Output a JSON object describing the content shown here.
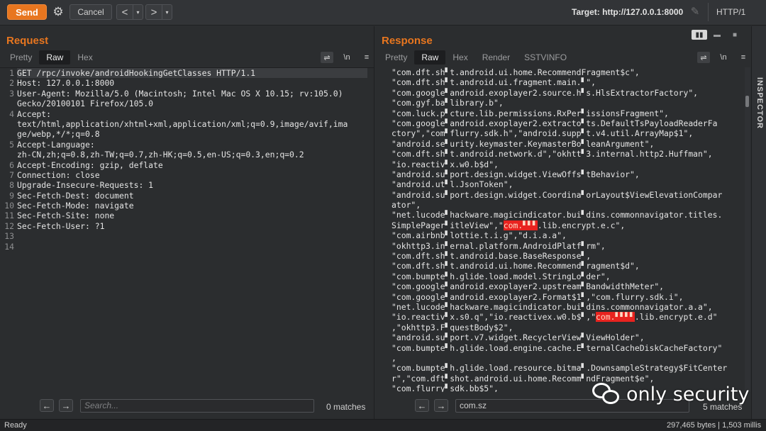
{
  "toolbar": {
    "send_label": "Send",
    "cancel_label": "Cancel",
    "back_arrow": "<",
    "forward_arrow": ">",
    "dropdown": "▾",
    "target": "Target: http://127.0.0.1:8000",
    "http_version": "HTTP/1"
  },
  "request": {
    "title": "Request",
    "tabs": [
      "Pretty",
      "Raw",
      "Hex"
    ],
    "active_tab": "Raw",
    "newline_label": "\\n",
    "line_numbers": [
      "1",
      "2",
      "3",
      "",
      "4",
      "",
      "",
      "5",
      "",
      "6",
      "7",
      "8",
      "9",
      "10",
      "11",
      "12",
      "13",
      "14"
    ],
    "lines": [
      "GET /rpc/invoke/androidHookingGetClasses HTTP/1.1",
      "Host: 127.0.0.1:8000",
      "User-Agent: Mozilla/5.0 (Macintosh; Intel Mac OS X 10.15; rv:105.0)",
      "Gecko/20100101 Firefox/105.0",
      "Accept:",
      "text/html,application/xhtml+xml,application/xml;q=0.9,image/avif,ima",
      "ge/webp,*/*;q=0.8",
      "Accept-Language:",
      "zh-CN,zh;q=0.8,zh-TW;q=0.7,zh-HK;q=0.5,en-US;q=0.3,en;q=0.2",
      "Accept-Encoding: gzip, deflate",
      "Connection: close",
      "Upgrade-Insecure-Requests: 1",
      "Sec-Fetch-Dest: document",
      "Sec-Fetch-Mode: navigate",
      "Sec-Fetch-Site: none",
      "Sec-Fetch-User: ?1",
      "",
      ""
    ],
    "search_placeholder": "Search...",
    "matches": "0 matches"
  },
  "response": {
    "title": "Response",
    "tabs": [
      "Pretty",
      "Raw",
      "Hex",
      "Render",
      "SSTVINFO"
    ],
    "active_tab": "Raw",
    "newline_label": "\\n",
    "lines": [
      "\"com.dft.sh▘t.android.ui.home.RecommendFragment$c\",",
      "\"com.dft.sh▘t.android.ui.fragment.main.▘\",",
      "\"com.google▘android.exoplayer2.source.h▘s.HlsExtractorFactory\",",
      "\"com.gyf.ba▘library.b\",",
      "\"com.luck.p▘cture.lib.permissions.RxPer▘issionsFragment\",",
      "\"com.google▘android.exoplayer2.extracto▘ts.DefaultTsPayloadReaderFa",
      "ctory\",\"com▘flurry.sdk.h\",\"android.supp▘t.v4.util.ArrayMap$1\",",
      "\"android.se▘urity.keymaster.KeymasterBo▘leanArgument\",",
      "\"com.dft.sh▘t.android.network.d\",\"okhtt▘3.internal.http2.Huffman\",",
      "\"io.reactiv▘x.w0.b$d\",",
      "\"android.su▘port.design.widget.ViewOffs▘tBehavior\",",
      "\"android.ut▘l.JsonToken\",",
      "\"android.su▘port.design.widget.Coordina▘orLayout$ViewElevationCompar",
      "ator\",",
      "\"net.lucode▘hackware.magicindicator.bui▘dins.commonnavigator.titles.",
      "SimplePager▘itleView\",\"",
      "\"com.airbnb▘lottie.t.i.g\",\"d.i.a.a\",",
      "\"okhttp3.in▘ernal.platform.AndroidPlatf▘rm\",",
      "\"com.dft.sh▘t.android.base.BaseResponse▘,",
      "\"com.dft.sh▘t.android.ui.home.Recommend▘ragment$d\",",
      "\"com.bumpte▘h.glide.load.model.StringLo▘der\",",
      "\"com.google▘android.exoplayer2.upstream▘BandwidthMeter\",",
      "\"com.google▘android.exoplayer2.Format$1▘,\"com.flurry.sdk.i\",",
      "\"net.lucode▘hackware.magicindicator.bui▘dins.commonnavigator.a.a\",",
      "\"io.reactiv▘x.s0.q\",\"io.reactivex.w0.b$▘,\"",
      ",\"okhttp3.F▘questBody$2\",",
      "\"android.su▘port.v7.widget.RecyclerView▘ViewHolder\",",
      "\"com.bumpte▘h.glide.load.engine.cache.E▘ternalCacheDiskCacheFactory\"",
      ",",
      "\"com.bumpte▘h.glide.load.resource.bitma▘.DownsampleStrategy$FitCenter",
      "r\",\"com.dft▘shot.android.ui.home.Recomm▘ndFragment$e\",",
      "\"com.flurry▘sdk.bb$5\","
    ],
    "highlight_1": "com.▘▘▘.lib.encrypt.e.c",
    "highlight_1_prefix": "com.",
    "highlight_1_suffix": ".lib.enc",
    "highlight_1_tail": "rypt.e.c\",",
    "highlight_2": "com.",
    "highlight_2_tail": ".lib.encrypt.e.d\"",
    "search_value": "com.sz",
    "matches": "5 matches"
  },
  "inspector": {
    "label": "INSPECTOR"
  },
  "status": {
    "left": "Ready",
    "right": "297,465 bytes | 1,503 millis"
  },
  "watermark": {
    "text": "only security"
  },
  "colors": {
    "accent": "#e8761f",
    "highlight": "#e8231f",
    "background": "#2b2d2f"
  },
  "icons": [
    "gear-icon",
    "pencil-icon",
    "wrap-icon",
    "menu-icon",
    "wechat-icon",
    "arrow-left-icon",
    "arrow-right-icon"
  ]
}
